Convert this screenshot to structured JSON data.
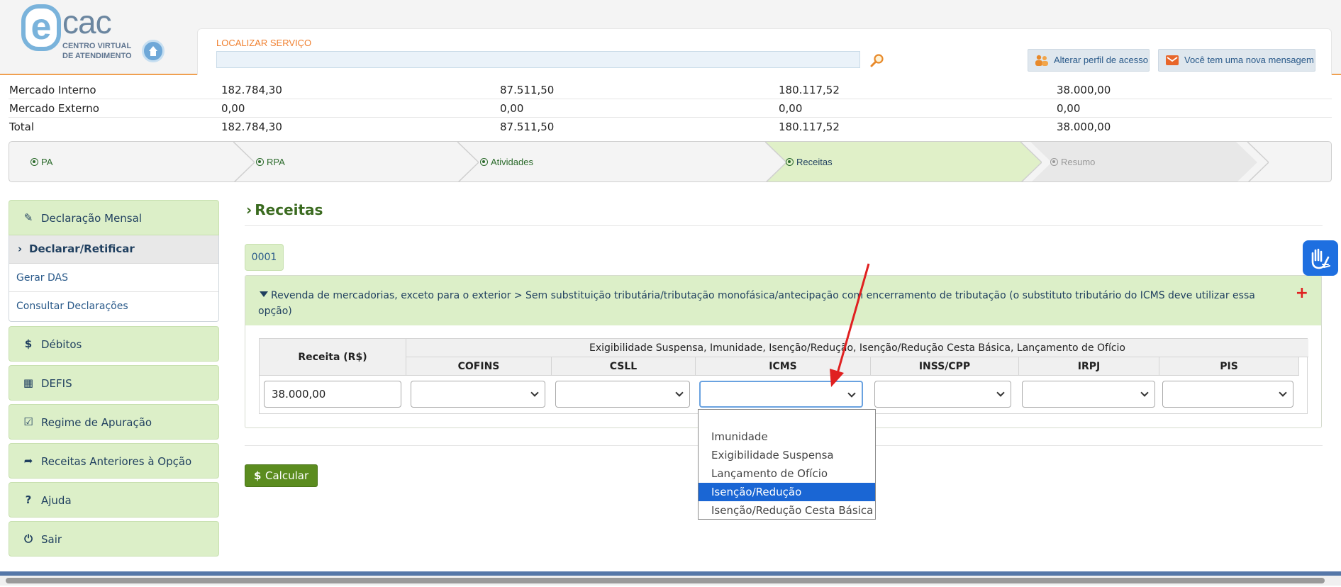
{
  "header": {
    "logo_main": "cac",
    "logo_sub": "CENTRO VIRTUAL DE ATENDIMENTO",
    "search_label": "LOCALIZAR SERVIÇO",
    "search_value": "",
    "btn_perfil": "Alterar perfil de acesso",
    "btn_msg": "Você tem uma nova mensagem"
  },
  "summary_table": {
    "rows": [
      {
        "label": "Mercado Interno",
        "values": [
          "182.784,30",
          "87.511,50",
          "180.117,52",
          "38.000,00"
        ]
      },
      {
        "label": "Mercado Externo",
        "values": [
          "0,00",
          "0,00",
          "0,00",
          "0,00"
        ]
      },
      {
        "label": "Total",
        "values": [
          "182.784,30",
          "87.511,50",
          "180.117,52",
          "38.000,00"
        ]
      }
    ]
  },
  "stepper": {
    "steps": [
      {
        "label": "PA",
        "state": "done"
      },
      {
        "label": "RPA",
        "state": "done"
      },
      {
        "label": "Atividades",
        "state": "done"
      },
      {
        "label": "Receitas",
        "state": "active"
      },
      {
        "label": "Resumo",
        "state": "pending"
      }
    ]
  },
  "sidebar": {
    "declaracao_mensal": "Declaração Mensal",
    "declarar": "Declarar/Retificar",
    "gerar_das": "Gerar DAS",
    "consultar": "Consultar Declarações",
    "debitos": "Débitos",
    "defis": "DEFIS",
    "regime": "Regime de Apuração",
    "receitas_anteriores": "Receitas Anteriores à Opção",
    "ajuda": "Ajuda",
    "sair": "Sair"
  },
  "main": {
    "title": "Receitas",
    "tab": "0001",
    "activity_text": "Revenda de mercadorias, exceto para o exterior > Sem substituição tributária/tributação monofásica/antecipação com encerramento de tributação (o substituto tributário do ICMS deve utilizar essa opção)",
    "grid": {
      "receita_header": "Receita (R$)",
      "group_header": "Exigibilidade Suspensa, Imunidade, Isenção/Redução, Isenção/Redução Cesta Básica, Lançamento de Ofício",
      "columns": [
        "COFINS",
        "CSLL",
        "ICMS",
        "INSS/CPP",
        "IRPJ",
        "PIS"
      ],
      "receita_value": "38.000,00"
    },
    "calc_button": "Calcular"
  },
  "dropdown": {
    "options": [
      "",
      "Imunidade",
      "Exigibilidade Suspensa",
      "Lançamento de Ofício",
      "Isenção/Redução",
      "Isenção/Redução Cesta Básica"
    ],
    "highlighted": "Isenção/Redução"
  },
  "colors": {
    "accent_green": "#5b8c1f",
    "panel_green": "#dcefc8",
    "header_orange": "#f08030",
    "selected_blue": "#1a66d4",
    "arrow_red": "#e02020"
  }
}
